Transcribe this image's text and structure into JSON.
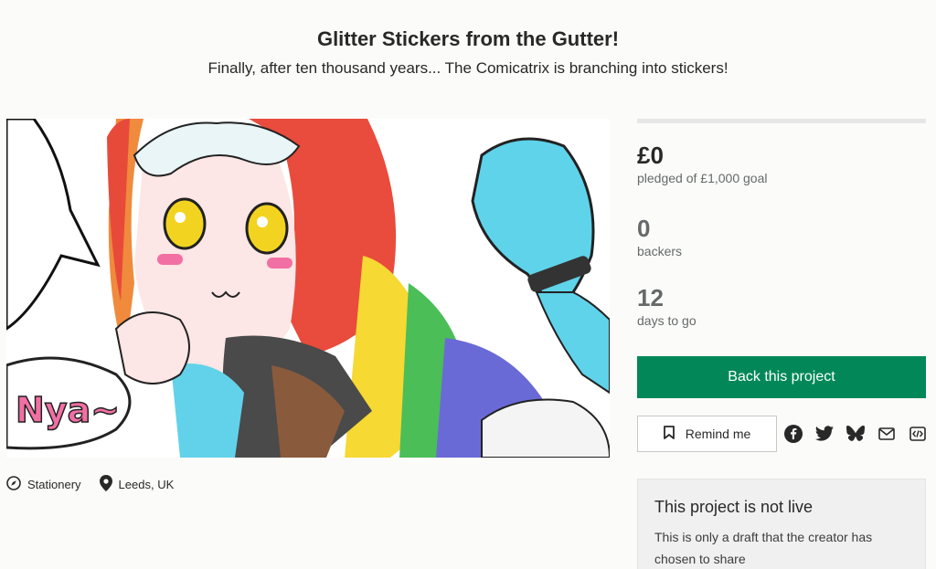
{
  "project": {
    "title": "Glitter Stickers from the Gutter!",
    "subtitle": "Finally, after ten thousand years... The Comicatrix is branching into stickers!",
    "hero_art_text": "Nya~"
  },
  "meta": {
    "category": "Stationery",
    "location": "Leeds, UK"
  },
  "stats": {
    "pledged": "£0",
    "pledged_label": "pledged of £1,000 goal",
    "progress_fraction": 0,
    "backers": "0",
    "backers_label": "backers",
    "days": "12",
    "days_label": "days to go"
  },
  "actions": {
    "back_label": "Back this project",
    "remind_label": "Remind me",
    "share_icons": [
      "facebook-icon",
      "twitter-icon",
      "bluesky-icon",
      "email-icon",
      "embed-icon"
    ]
  },
  "notice": {
    "title": "This project is not live",
    "text": "This is only a draft that the creator has chosen to share"
  },
  "colors": {
    "accent_green": "#028858",
    "progress_green": "#05ce78"
  }
}
